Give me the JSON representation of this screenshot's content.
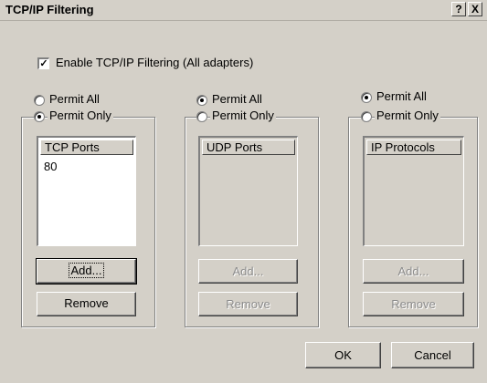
{
  "window": {
    "title": "TCP/IP Filtering",
    "help_button": "?",
    "close_button": "X"
  },
  "enable": {
    "checked": true,
    "label": "Enable TCP/IP Filtering (All adapters)"
  },
  "tcp": {
    "permit_all": "Permit All",
    "permit_only": "Permit Only",
    "selected": "permit_only",
    "list_header": "TCP Ports",
    "items": [
      "80"
    ],
    "add_label": "Add...",
    "remove_label": "Remove",
    "enabled": true
  },
  "udp": {
    "permit_all": "Permit All",
    "permit_only": "Permit Only",
    "selected": "permit_all",
    "list_header": "UDP Ports",
    "items": [],
    "add_label": "Add...",
    "remove_label": "Remove",
    "enabled": false
  },
  "ip": {
    "permit_all": "Permit All",
    "permit_only": "Permit Only",
    "selected": "permit_all",
    "list_header": "IP Protocols",
    "items": [],
    "add_label": "Add...",
    "remove_label": "Remove",
    "enabled": false
  },
  "footer": {
    "ok_label": "OK",
    "cancel_label": "Cancel"
  }
}
